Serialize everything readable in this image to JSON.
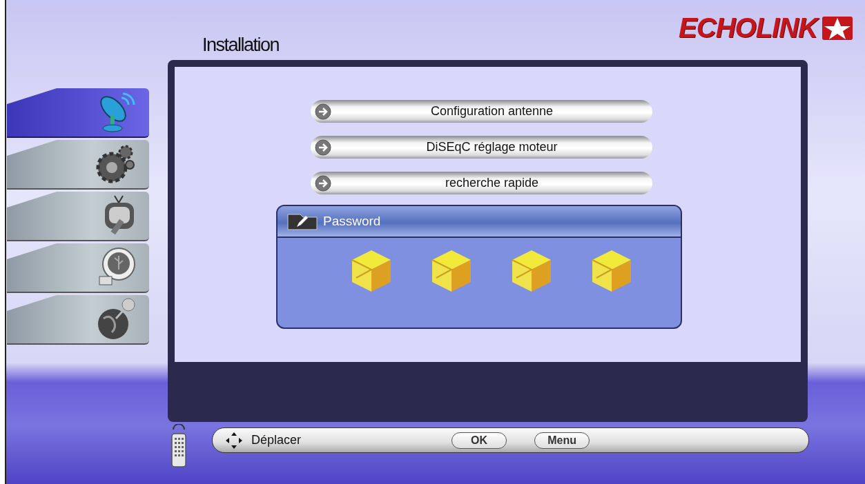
{
  "header": {
    "title": "Installation",
    "logo": "ECHOLINK"
  },
  "sidebar": {
    "items": [
      {
        "kind": "satellite",
        "selected": true
      },
      {
        "kind": "gears",
        "selected": false
      },
      {
        "kind": "tv",
        "selected": false
      },
      {
        "kind": "usb",
        "selected": false
      },
      {
        "kind": "globe",
        "selected": false
      }
    ]
  },
  "menu": {
    "items": [
      {
        "label": "Configuration antenne"
      },
      {
        "label": "DiSEqC réglage moteur"
      },
      {
        "label": "recherche rapide"
      }
    ]
  },
  "dialog": {
    "title": "Password",
    "digits": [
      {
        "entered": false
      },
      {
        "entered": false
      },
      {
        "entered": false
      },
      {
        "entered": false
      }
    ]
  },
  "footer": {
    "hints": [
      {
        "kind": "move",
        "label": "Déplacer"
      },
      {
        "kind": "key",
        "label": "OK"
      },
      {
        "kind": "key",
        "label": "Menu"
      }
    ]
  }
}
